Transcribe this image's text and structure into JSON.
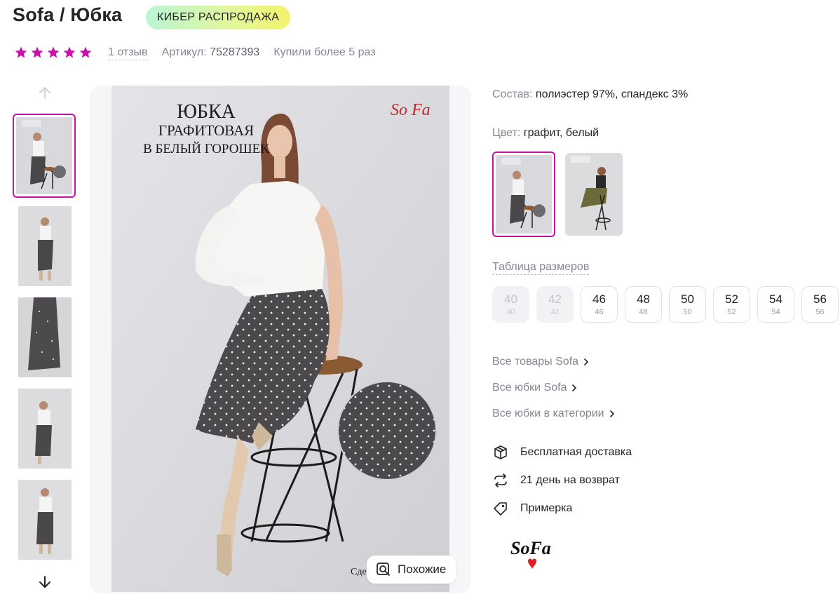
{
  "header": {
    "title": "Sofa / Юбка",
    "promo_badge": "КИБЕР РАСПРОДАЖА"
  },
  "meta": {
    "rating": 5,
    "reviews": "1 отзыв",
    "article_label": "Артикул:",
    "article_number": "75287393",
    "bought": "Купили более 5 раз"
  },
  "gallery": {
    "thumb_count": 5,
    "similar_button": "Похожие",
    "image_text": {
      "line1": "ЮБКА",
      "line2": "ГРАФИТОВАЯ",
      "line3": "В БЕЛЫЙ ГОРОШЕК",
      "logo": "So Fa",
      "bottom": "Сде"
    }
  },
  "details": {
    "composition_label": "Состав:",
    "composition_value": "полиэстер 97%, спандекс 3%",
    "color_label": "Цвет:",
    "color_value": "графит, белый",
    "size_table_link": "Таблица размеров",
    "sizes": [
      {
        "big": "40",
        "small": "40",
        "available": false
      },
      {
        "big": "42",
        "small": "42",
        "available": false
      },
      {
        "big": "46",
        "small": "46",
        "available": true
      },
      {
        "big": "48",
        "small": "48",
        "available": true
      },
      {
        "big": "50",
        "small": "50",
        "available": true
      },
      {
        "big": "52",
        "small": "52",
        "available": true
      },
      {
        "big": "54",
        "small": "54",
        "available": true
      },
      {
        "big": "56",
        "small": "56",
        "available": true
      }
    ]
  },
  "links": {
    "all_brand": "Все товары Sofa",
    "all_skirts_brand": "Все юбки Sofa",
    "all_skirts_category": "Все юбки в категории"
  },
  "features": {
    "delivery": "Бесплатная доставка",
    "returns": "21 день на возврат",
    "fitting": "Примерка"
  },
  "brand_logo": {
    "text": "SoFa"
  },
  "colors": {
    "accent": "#cb11ab",
    "star": "#cb11ab",
    "muted_text": "#868695",
    "main_text": "#242424"
  }
}
